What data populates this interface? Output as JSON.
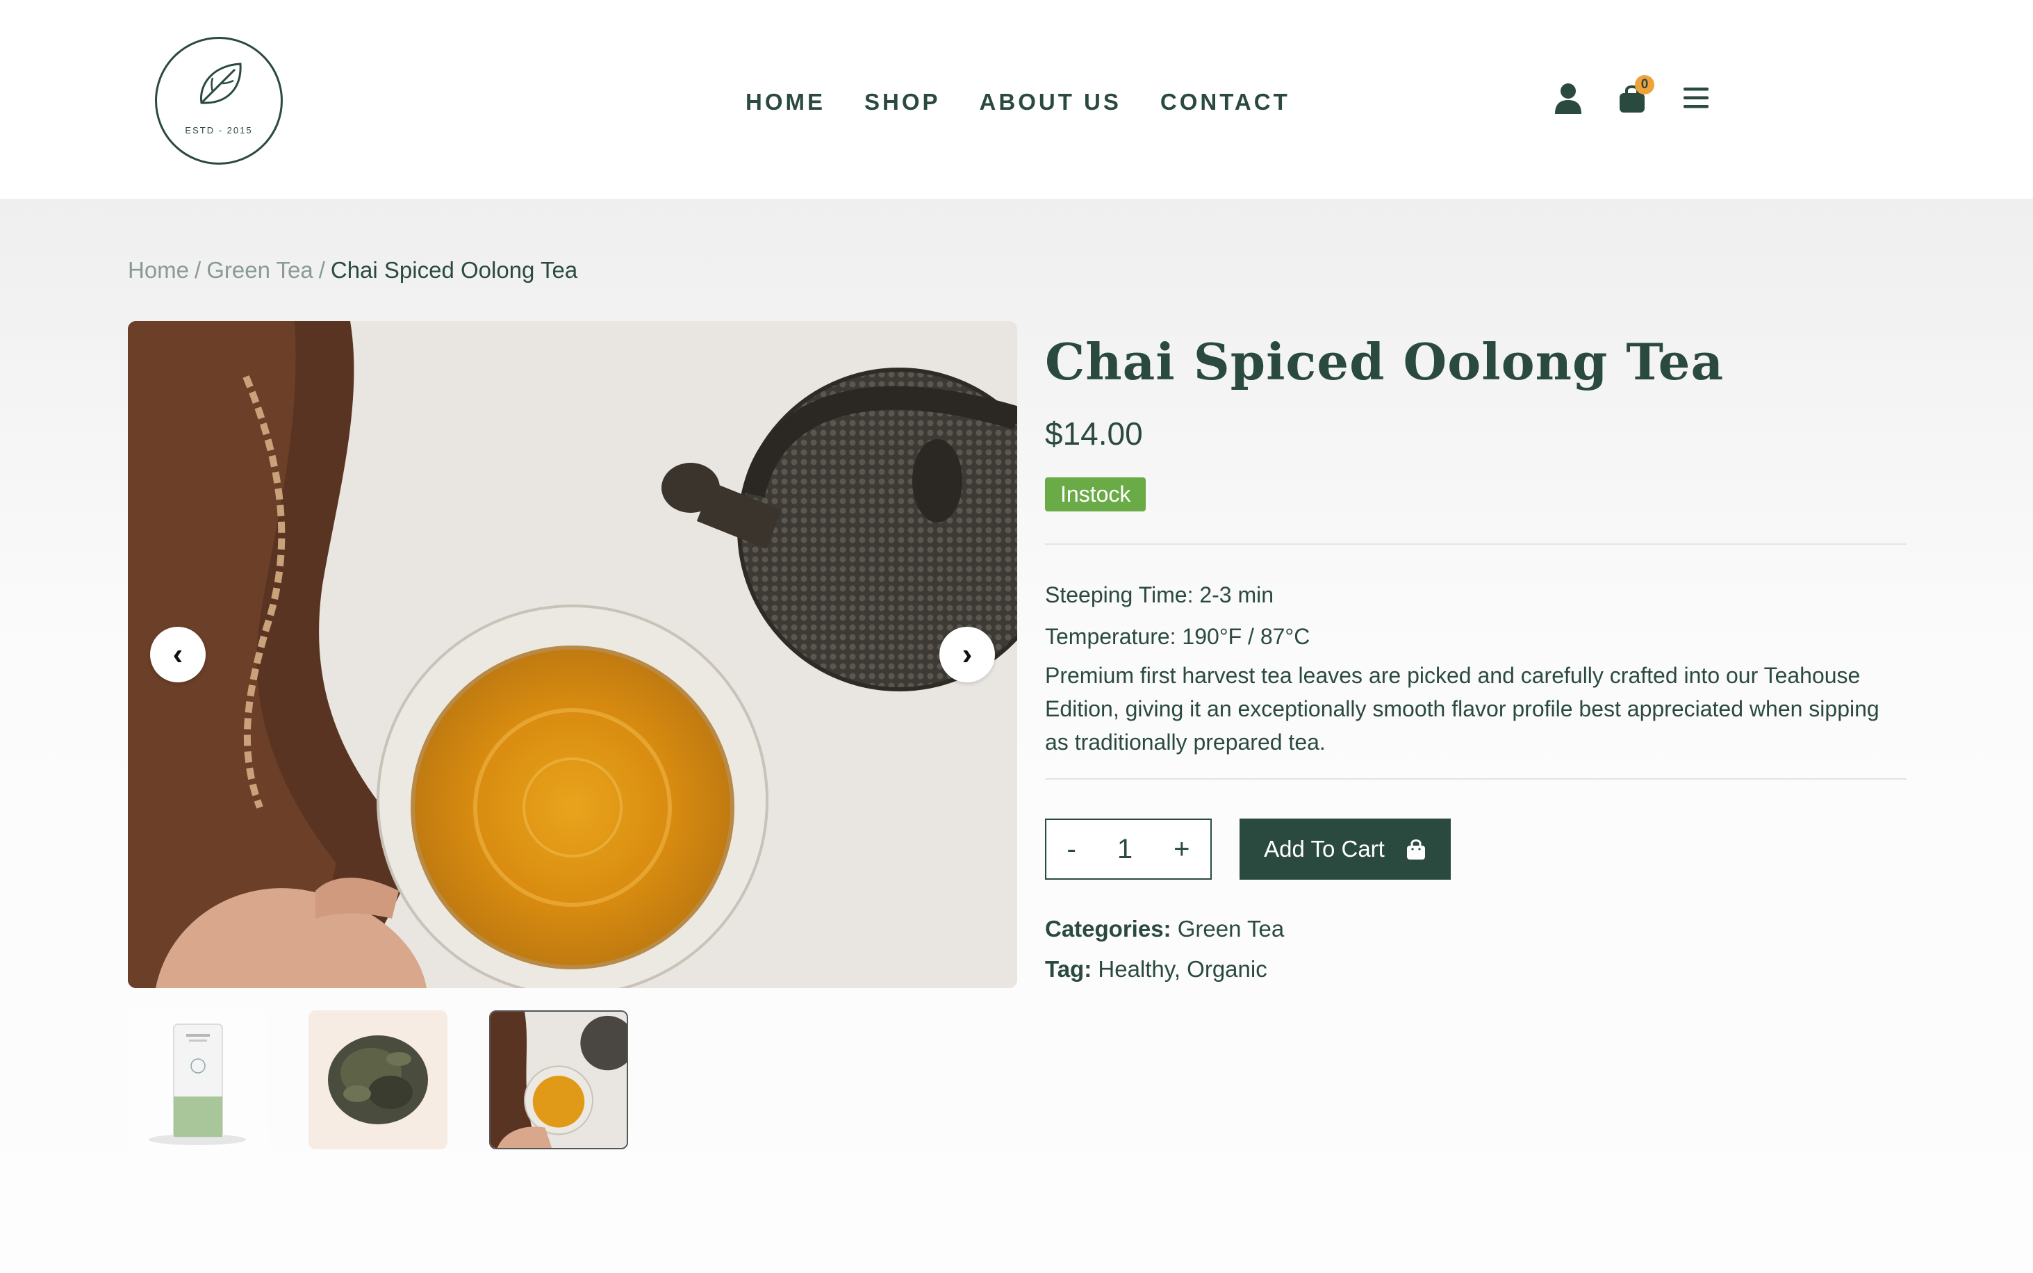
{
  "header": {
    "logo_text": "ESTD - 2015",
    "nav": [
      "HOME",
      "SHOP",
      "ABOUT US",
      "CONTACT"
    ],
    "cart_count": "0",
    "icons": [
      "user-icon",
      "cart-icon",
      "menu-icon"
    ]
  },
  "breadcrumb": {
    "home": "Home",
    "category": "Green Tea",
    "sep": "/",
    "current": "Chai Spiced Oolong Tea"
  },
  "gallery": {
    "prev_icon": "‹",
    "next_icon": "›",
    "thumbnails": [
      "tea-canister",
      "loose-leaf-tea",
      "teapot-and-cup"
    ]
  },
  "product": {
    "title": "Chai Spiced Oolong Tea",
    "price": "$14.00",
    "stock": "Instock",
    "steeping": "Steeping Time: 2-3 min",
    "temperature": "Temperature: 190°F / 87°C",
    "description": "Premium first harvest tea leaves are picked and carefully crafted into our Teahouse Edition, giving it an exceptionally smooth flavor profile best appreciated when sipping as traditionally prepared tea.",
    "qty_minus": "-",
    "qty_value": "1",
    "qty_plus": "+",
    "add_to_cart": "Add To Cart",
    "categories_label": "Categories:",
    "categories_value": "Green Tea",
    "tag_label": "Tag:",
    "tag_value": "Healthy, Organic"
  },
  "colors": {
    "brand": "#2a4a40",
    "stock_badge": "#6aab47",
    "cart_badge": "#f0a23a"
  }
}
